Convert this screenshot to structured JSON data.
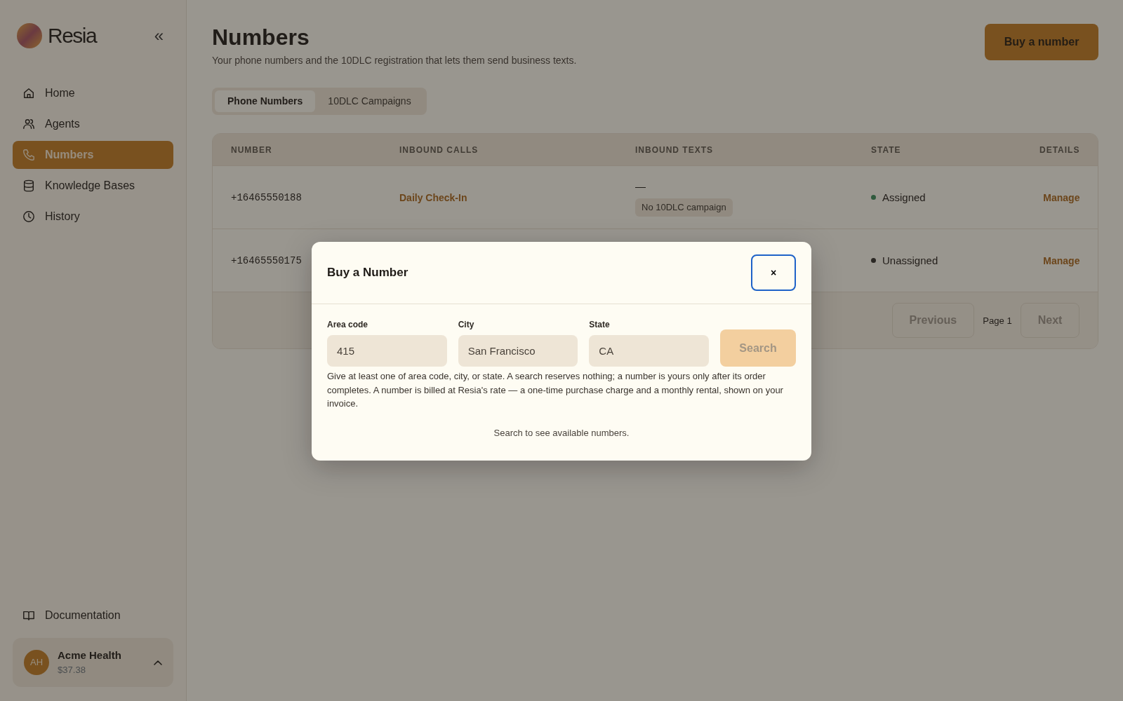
{
  "sidebar": {
    "brand": "Resia",
    "collapse_icon": "«",
    "items": [
      {
        "label": "Home",
        "kind": "home",
        "selected": false
      },
      {
        "label": "Agents",
        "kind": "people",
        "selected": false
      },
      {
        "label": "Numbers",
        "kind": "phone",
        "selected": true
      },
      {
        "label": "Knowledge Bases",
        "kind": "database",
        "selected": false
      },
      {
        "label": "History",
        "kind": "clock",
        "selected": false
      }
    ],
    "footer_link": {
      "label": "Documentation",
      "kind": "book"
    },
    "account": {
      "initials": "AH",
      "name": "Acme Health",
      "balance": "$37.38",
      "expanded": true
    }
  },
  "header": {
    "title": "Numbers",
    "subtitle": "Your phone numbers and the 10DLC registration that lets them send business texts.",
    "action": "Buy a number"
  },
  "tabs": [
    {
      "label": "Phone Numbers",
      "selected": true
    },
    {
      "label": "10DLC Campaigns",
      "selected": false
    }
  ],
  "table": {
    "columns": [
      "NUMBER",
      "INBOUND CALLS",
      "INBOUND TEXTS",
      "STATE",
      "DETAILS"
    ],
    "rows": [
      {
        "number": "+16465550188",
        "inbound_calls": "Daily Check-In",
        "inbound_texts": "—",
        "texts_badge": "No 10DLC campaign",
        "state": "Assigned",
        "color": "#2f5a3d",
        "details": "Manage"
      },
      {
        "number": "+16465550175",
        "state": "Unassigned",
        "color": "#2b2824",
        "details": "Manage"
      }
    ],
    "pagination": {
      "previous": {
        "label": "Previous",
        "disabled": true
      },
      "page": "Page 1",
      "next": {
        "label": "Next",
        "disabled": true
      }
    }
  },
  "modal": {
    "title": "Buy a Number",
    "close": "×",
    "close_focused": true,
    "fields": [
      {
        "label": "Area code",
        "value": "415"
      },
      {
        "label": "City",
        "value": "San Francisco"
      },
      {
        "label": "State",
        "value": "CA"
      }
    ],
    "search": {
      "label": "Search",
      "disabled": true
    },
    "help": "Give at least one of area code, city, or state. A search reserves nothing; a number is yours only after its order completes. A number is billed at Resia's rate — a one-time purchase charge and a monthly rental, shown on your invoice.",
    "empty": "Search to see available numbers."
  }
}
